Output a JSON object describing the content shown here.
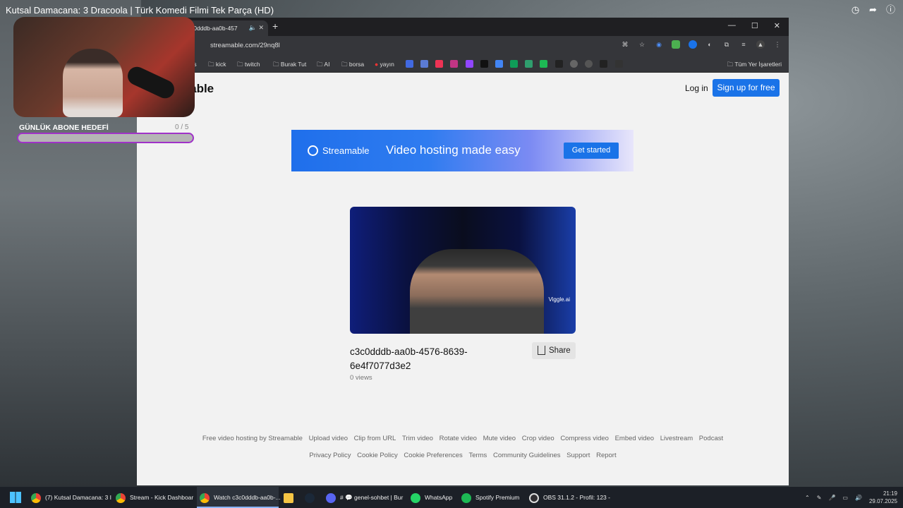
{
  "overlay": {
    "video_title": "Kutsal Damacana: 3 Dracoola | Türk Komedi Filmi Tek Parça (HD)",
    "goal_label": "GÜNLÜK ABONE HEDEFİ",
    "goal_count": "0 / 5",
    "goal_progress": 0
  },
  "browser": {
    "tab_title": "c0dddb-aa0b-457",
    "url": "streamable.com/29nq8l",
    "bookmarks": [
      "ts",
      "kick",
      "twitch",
      "Burak Tut",
      "AI",
      "borsa",
      "yayın"
    ],
    "all_bookmarks": "Tüm Yer İşaretleri"
  },
  "page": {
    "brand": "mable",
    "login": "Log in",
    "signup": "Sign up for free",
    "banner": {
      "logo": "Streamable",
      "tagline": "Video hosting made easy",
      "cta": "Get started"
    },
    "video": {
      "watermark": "Viggle.ai",
      "title": "c3c0dddb-aa0b-4576-8639-6e4f7077d3e2",
      "views": "0 views",
      "share": "Share"
    },
    "footer_links_1": [
      "Free video hosting by Streamable",
      "Upload video",
      "Clip from URL",
      "Trim video",
      "Rotate video",
      "Mute video",
      "Crop video",
      "Compress video",
      "Embed video",
      "Livestream",
      "Podcast"
    ],
    "footer_links_2": [
      "Privacy Policy",
      "Cookie Policy",
      "Cookie Preferences",
      "Terms",
      "Community Guidelines",
      "Support",
      "Report"
    ]
  },
  "taskbar": {
    "items": [
      {
        "label": "(7) Kutsal Damacana: 3 I",
        "icon": "chrome-icon"
      },
      {
        "label": "Stream - Kick Dashboar",
        "icon": "chrome-icon"
      },
      {
        "label": "Watch c3c0dddb-aa0b-...",
        "icon": "chrome-icon"
      },
      {
        "label": "",
        "icon": "folder-icon"
      },
      {
        "label": "",
        "icon": "steam-icon"
      },
      {
        "label": "# 💬 genel-sohbet | Bur",
        "icon": "discord-icon"
      },
      {
        "label": "WhatsApp",
        "icon": "whatsapp-icon"
      },
      {
        "label": "Spotify Premium",
        "icon": "spotify-icon"
      },
      {
        "label": "OBS 31.1.2 - Profil: 123 -",
        "icon": "obs-icon"
      }
    ],
    "time": "21:19",
    "date": "29.07.2025"
  }
}
